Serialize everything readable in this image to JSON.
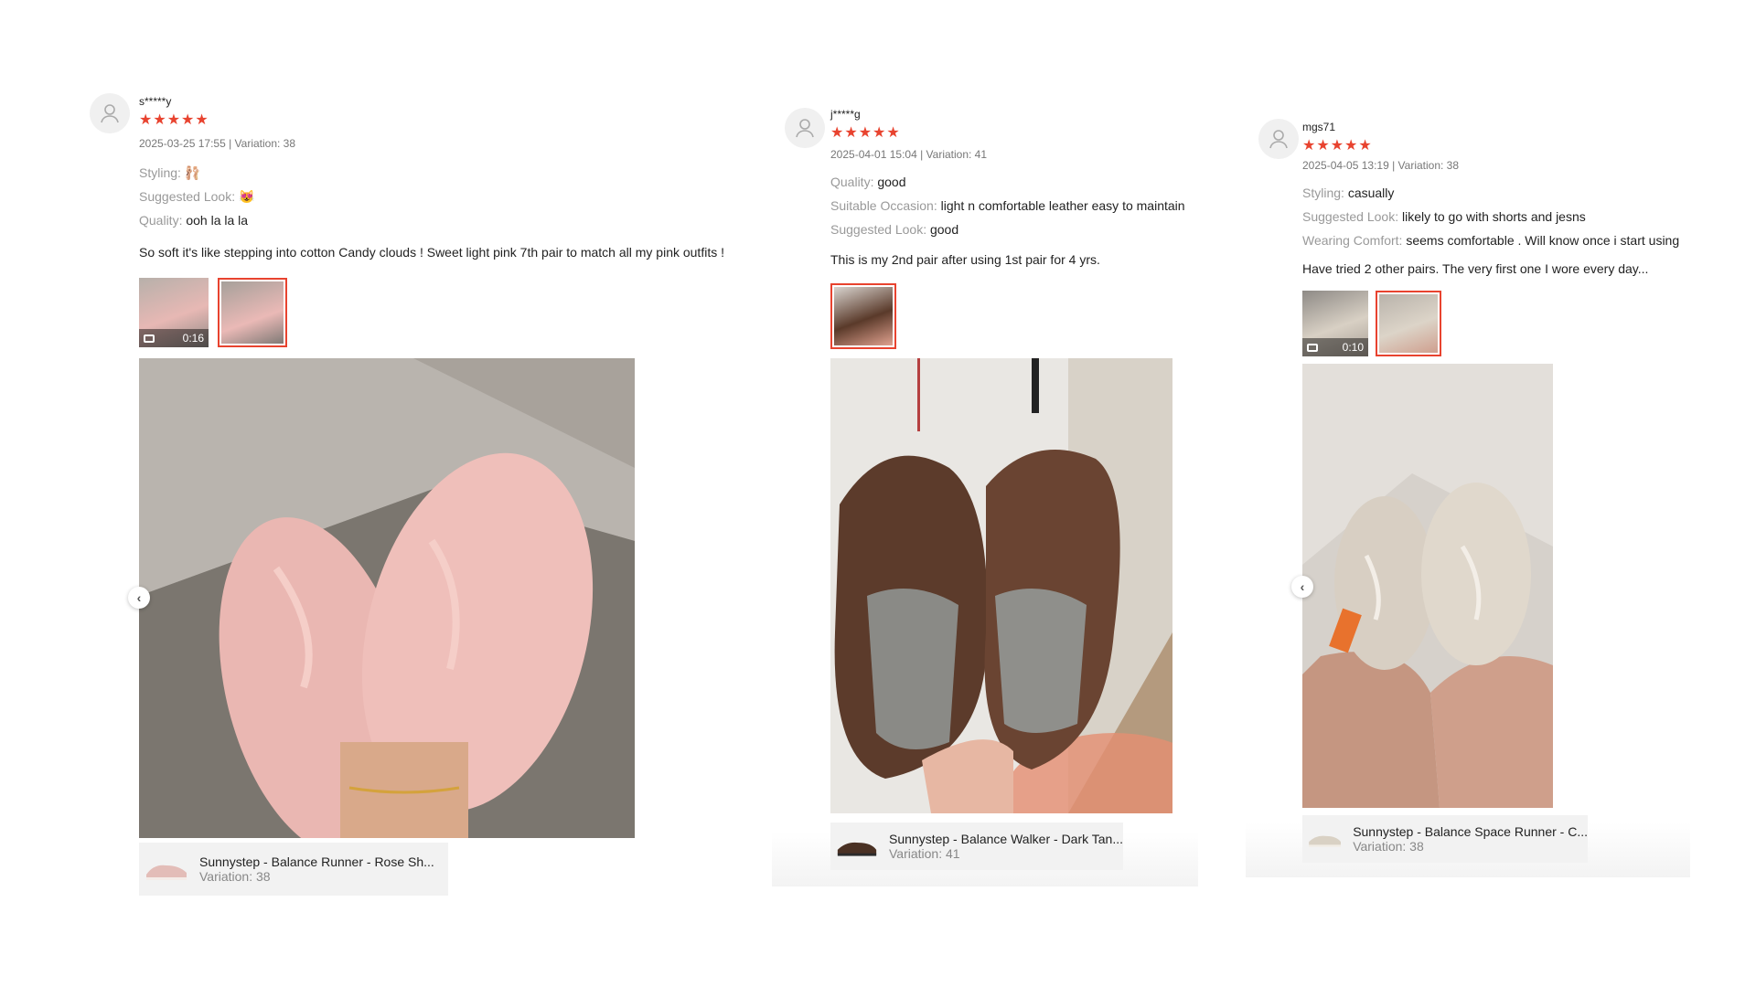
{
  "reviews": [
    {
      "username": "s*****y",
      "stars": "★★★★★",
      "meta": "2025-03-25 17:55 | Variation: 38",
      "attributes": [
        {
          "label": "Styling: ",
          "value": "🩰"
        },
        {
          "label": "Suggested Look: ",
          "value": "😻"
        },
        {
          "label": "Quality: ",
          "value": "ooh la la la"
        }
      ],
      "text": "So soft it's like stepping into cotton Candy clouds ! Sweet light pink 7th pair to match all my pink outfits !",
      "video_duration": "0:16",
      "product": {
        "title": "Sunnystep - Balance Runner - Rose Sh...",
        "variation": "Variation: 38"
      }
    },
    {
      "username": "j*****g",
      "stars": "★★★★★",
      "meta": "2025-04-01 15:04 | Variation: 41",
      "attributes": [
        {
          "label": "Quality: ",
          "value": "good"
        },
        {
          "label": "Suitable Occasion: ",
          "value": "light n comfortable leather easy to maintain"
        },
        {
          "label": "Suggested Look: ",
          "value": "good"
        }
      ],
      "text": "This is my 2nd pair after using 1st pair for 4 yrs.",
      "product": {
        "title": "Sunnystep - Balance Walker - Dark Tan...",
        "variation": "Variation: 41"
      }
    },
    {
      "username": "mgs71",
      "stars": "★★★★★",
      "meta": "2025-04-05 13:19 | Variation: 38",
      "attributes": [
        {
          "label": "Styling: ",
          "value": "casually"
        },
        {
          "label": "Suggested Look: ",
          "value": "likely to go with shorts and jesns"
        },
        {
          "label": "Wearing Comfort: ",
          "value": "seems comfortable . Will know once i start using"
        }
      ],
      "text": "Have tried 2 other pairs. The very first one I wore every day...",
      "video_duration": "0:10",
      "product": {
        "title": "Sunnystep - Balance Space Runner - C...",
        "variation": "Variation: 38"
      }
    }
  ],
  "icons": {
    "avatar": "user-avatar-icon",
    "prev": "chevron-left-icon",
    "video": "video-camera-icon"
  },
  "colors": {
    "star": "#e8432f",
    "selected_border": "#e8432f",
    "pink_shoe": "#efb9b6",
    "brown_shoe": "#5a3a2a",
    "beige_shoe": "#d9d0c4"
  }
}
